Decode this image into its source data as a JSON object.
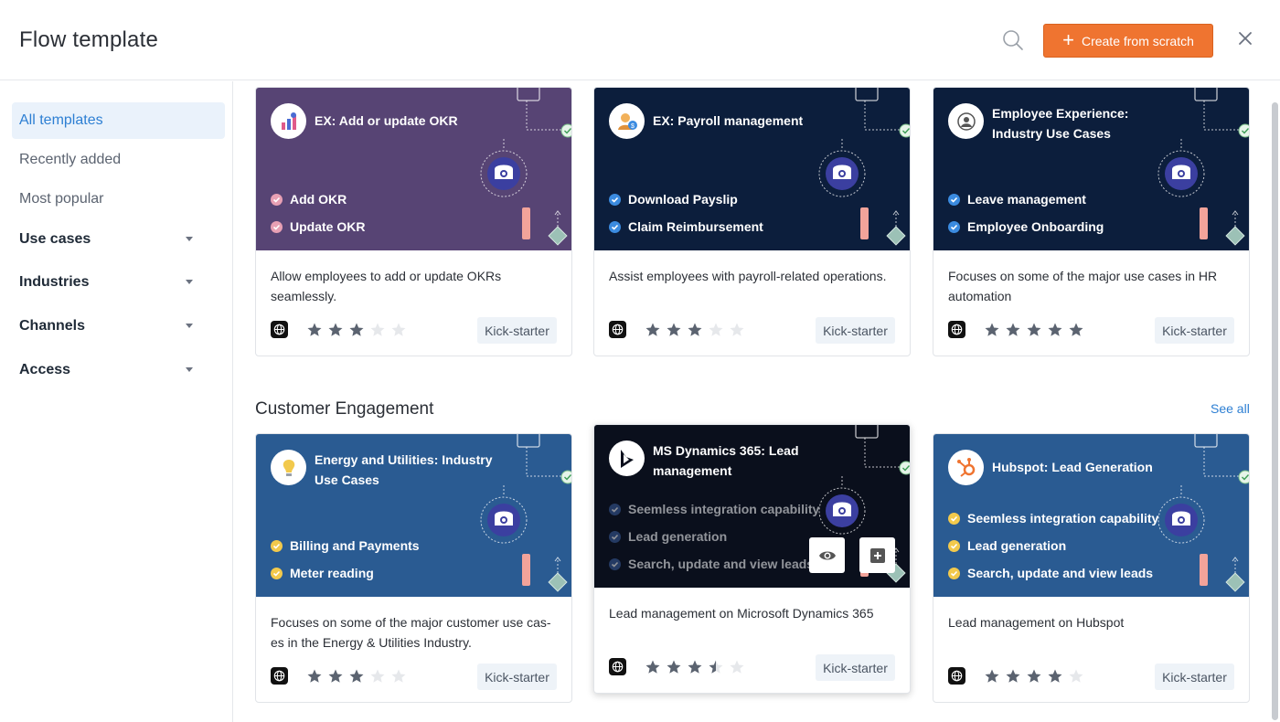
{
  "header": {
    "title": "Flow template",
    "create_label": "Create from scratch",
    "accent": "#ef7430"
  },
  "sidebar": {
    "items": [
      {
        "label": "All templates",
        "active": true
      },
      {
        "label": "Recently added"
      },
      {
        "label": "Most popular"
      },
      {
        "label": "Use cases",
        "expandable": true
      },
      {
        "label": "Industries",
        "expandable": true
      },
      {
        "label": "Channels",
        "expandable": true
      },
      {
        "label": "Access",
        "expandable": true
      }
    ]
  },
  "section": {
    "title": "Customer Engagement",
    "see_all": "See all"
  },
  "cards": [
    {
      "title": "EX: Add or update OKR",
      "features": [
        "Add OKR",
        "Update OKR"
      ],
      "description": "Allow employees to add or update OKRs seamlessly.",
      "rating": 3,
      "tag": "Kick-starter",
      "banner_color": "#574474",
      "check_color": "#e8a0b4",
      "logo_icon": "okr-icon"
    },
    {
      "title": "EX: Payroll management",
      "features": [
        "Download Payslip",
        "Claim Reimbursement"
      ],
      "description": "Assist employees with payroll-related operations.",
      "rating": 3,
      "tag": "Kick-starter",
      "banner_color": "#0c1e3c",
      "check_color": "#3b8be0",
      "logo_icon": "payroll-icon"
    },
    {
      "title": "Employee Experience: Industry Use Cases",
      "features": [
        "Leave management",
        "Employee Onboarding"
      ],
      "description": "Focuses on some of the major use cases in HR automation",
      "rating": 5,
      "tag": "Kick-starter",
      "banner_color": "#0c1e3c",
      "check_color": "#3b8be0",
      "logo_icon": "hr-icon"
    },
    {
      "title": "Energy and Utilities: Industry Use Cases",
      "features": [
        "Billing and Payments",
        "Meter reading"
      ],
      "description": "Focuses on some of the major customer use cas-es in the Energy & Utilities Industry.",
      "rating": 3,
      "tag": "Kick-starter",
      "banner_color": "#2a5b92",
      "check_color": "#f2c94c",
      "logo_icon": "lightbulb-icon"
    },
    {
      "title": "MS Dynamics 365: Lead management",
      "features": [
        "Seemless integration capability",
        "Lead generation",
        "Search, update and view leads"
      ],
      "description": "Lead management on Microsoft Dynamics 365",
      "rating": 3.5,
      "tag": "Kick-starter",
      "banner_color": "#0a0f1c",
      "check_color": "#3b5e9e",
      "logo_icon": "dynamics-icon"
    },
    {
      "title": "Hubspot: Lead Generation",
      "features": [
        "Seemless integration capability",
        "Lead generation",
        "Search, update and view leads"
      ],
      "description": "Lead management on Hubspot",
      "rating": 4,
      "tag": "Kick-starter",
      "banner_color": "#2a5b92",
      "check_color": "#f2c94c",
      "logo_icon": "hubspot-icon"
    }
  ]
}
